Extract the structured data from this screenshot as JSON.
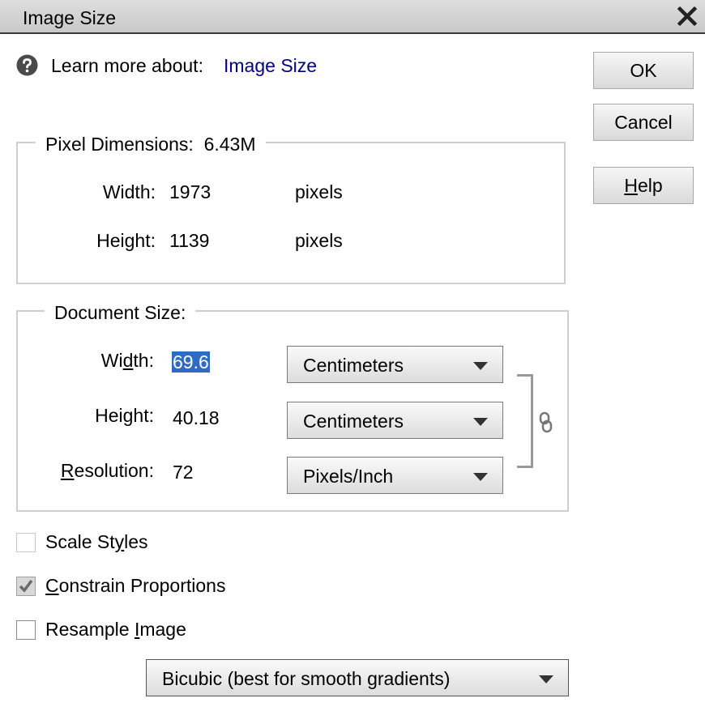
{
  "window": {
    "title": "Image Size",
    "close_icon": "close-icon"
  },
  "learn_more": {
    "label": "Learn more about:",
    "link": "Image Size",
    "icon": "help-circle-icon"
  },
  "buttons": {
    "ok": "OK",
    "cancel": "Cancel",
    "help": "Help"
  },
  "pixel_dimensions": {
    "legend": "Pixel Dimensions:",
    "size": "6.43M",
    "width": {
      "label": "Width:",
      "value": "1973",
      "unit": "pixels"
    },
    "height": {
      "label": "Height:",
      "value": "1139",
      "unit": "pixels"
    }
  },
  "document_size": {
    "legend": "Document Size:",
    "width": {
      "label": "Width:",
      "value": "69.6",
      "unit": "Centimeters"
    },
    "height": {
      "label": "Height:",
      "value": "40.18",
      "unit": "Centimeters"
    },
    "resolution": {
      "label": "Resolution:",
      "value": "72",
      "unit": "Pixels/Inch"
    },
    "link_icon": "chain-link-icon"
  },
  "options": {
    "scale_styles": {
      "label": "Scale Styles",
      "checked": false
    },
    "constrain_proportions": {
      "label": "Constrain Proportions",
      "checked": true
    },
    "resample_image": {
      "label": "Resample Image",
      "checked": false
    }
  },
  "resample_method": {
    "value": "Bicubic (best for smooth gradients)"
  },
  "colors": {
    "link": "#000080",
    "selection": "#316ac5",
    "group_border": "#cfcfcf"
  }
}
